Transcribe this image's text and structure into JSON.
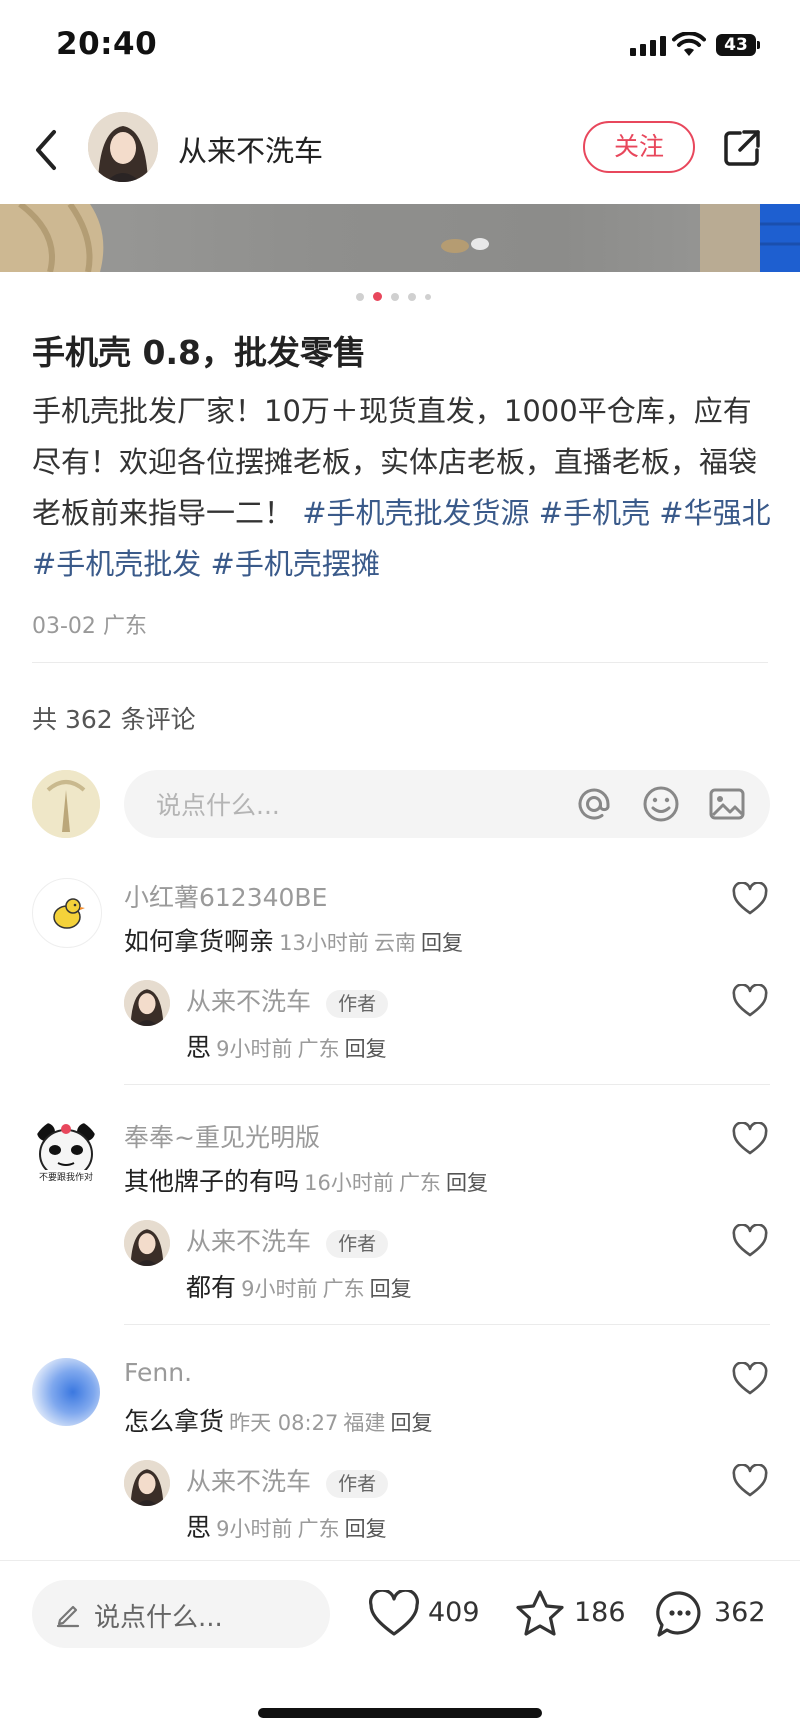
{
  "status_bar": {
    "time": "20:40",
    "battery": "43"
  },
  "header": {
    "author_name": "从来不洗车",
    "follow_label": "关注"
  },
  "post": {
    "title": "手机壳 0.8，批发零售",
    "body_text": "手机壳批发厂家！10万＋现货直发，1000平仓库，应有尽有！欢迎各位摆摊老板，实体店老板，直播老板，福袋老板前来指导一二！",
    "tags": [
      "#手机壳批发货源",
      "#手机壳",
      "#华强北",
      "#手机壳批发",
      "#手机壳摆摊"
    ],
    "date": "03-02",
    "location": "广东"
  },
  "comments_header": {
    "count_text": "共 362 条评论"
  },
  "comment_input": {
    "placeholder": "说点什么..."
  },
  "comments": [
    {
      "name": "小红薯612340BE",
      "text": "如何拿货啊亲",
      "time": "13小时前",
      "location": "云南",
      "reply_label": "回复",
      "reply": {
        "name": "从来不洗车",
        "badge": "作者",
        "text": "思",
        "time": "9小时前",
        "location": "广东",
        "reply_label": "回复"
      }
    },
    {
      "name": "奉奉~重见光明版",
      "text": "其他牌子的有吗",
      "time": "16小时前",
      "location": "广东",
      "reply_label": "回复",
      "avatar_caption": "不要跟我作对",
      "reply": {
        "name": "从来不洗车",
        "badge": "作者",
        "text": "都有",
        "time": "9小时前",
        "location": "广东",
        "reply_label": "回复"
      }
    },
    {
      "name": "Fenn.",
      "text": "怎么拿货",
      "time": "昨天 08:27",
      "location": "福建",
      "reply_label": "回复",
      "reply": {
        "name": "从来不洗车",
        "badge": "作者",
        "text": "思",
        "time": "9小时前",
        "location": "广东",
        "reply_label": "回复"
      }
    }
  ],
  "bottom_bar": {
    "placeholder": "说点什么...",
    "likes": "409",
    "stars": "186",
    "comments": "362"
  },
  "colors": {
    "accent": "#e8475c",
    "tag": "#3a5a8a",
    "muted": "#9a9a9a"
  },
  "icons": [
    "back-icon",
    "share-icon",
    "at-icon",
    "emoji-icon",
    "image-icon",
    "heart-icon",
    "star-icon",
    "comment-icon",
    "pencil-icon"
  ]
}
